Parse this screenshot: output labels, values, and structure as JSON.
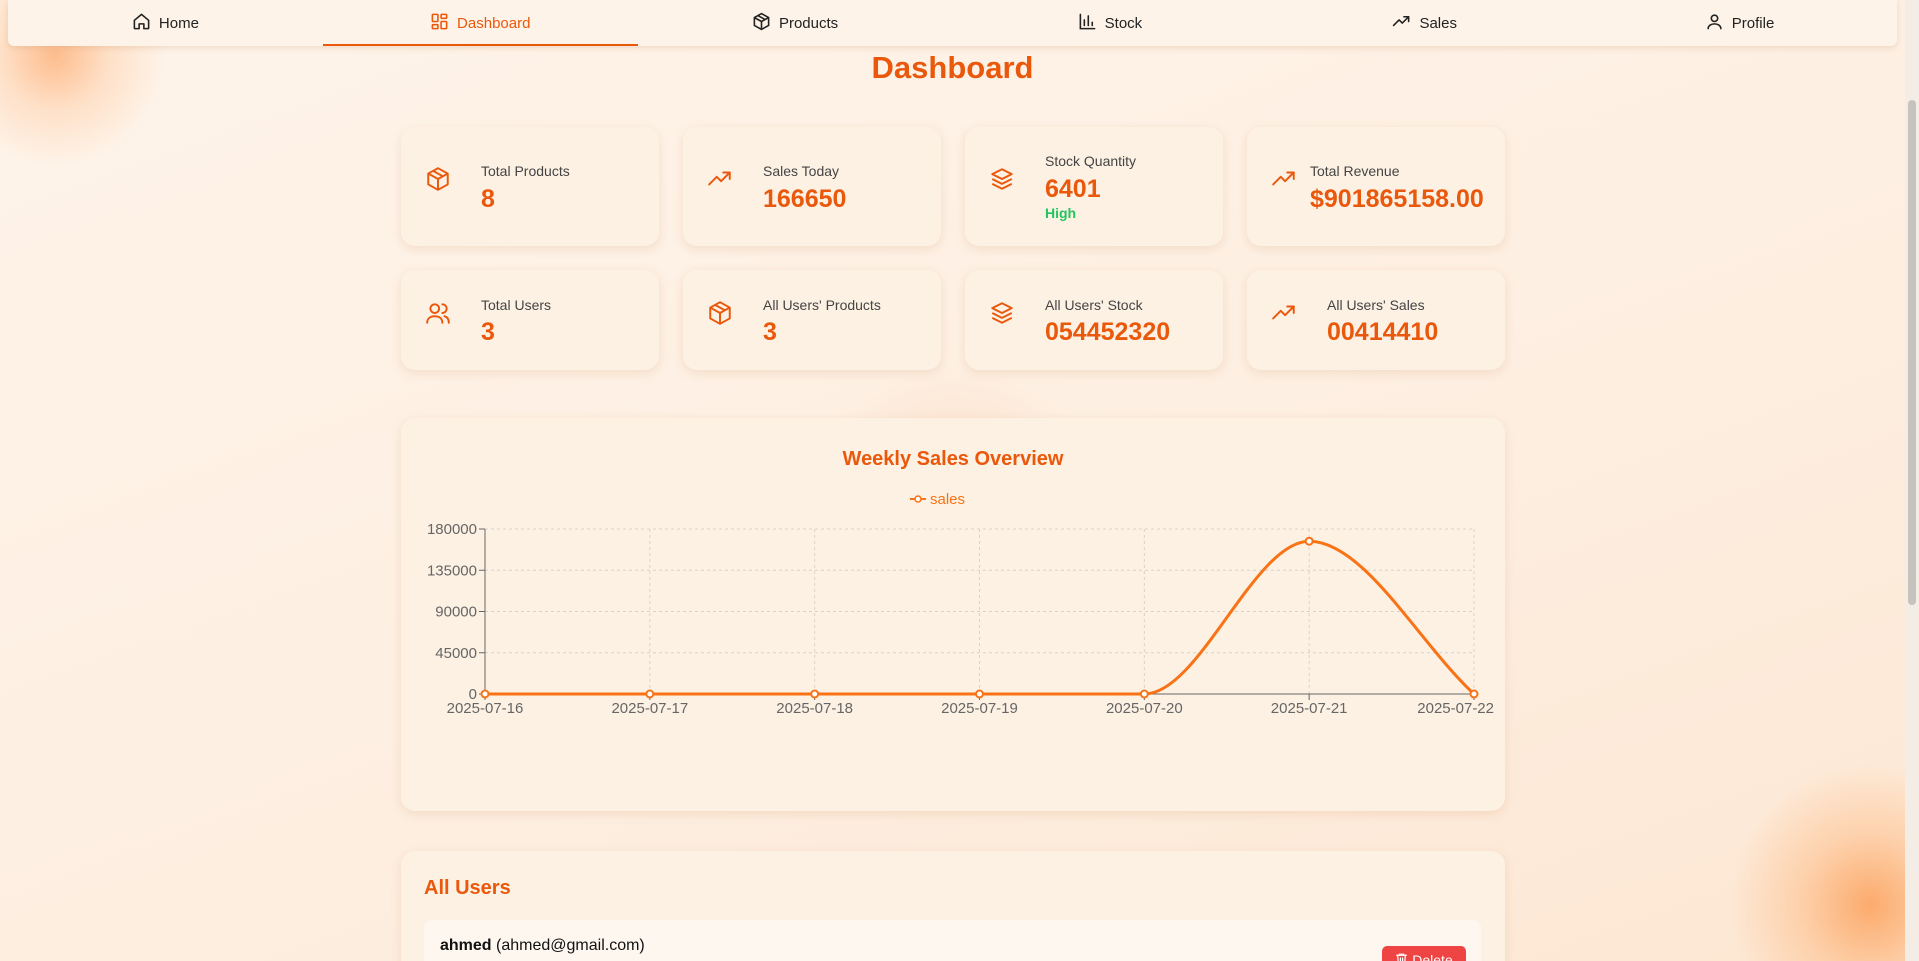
{
  "nav": {
    "items": [
      {
        "label": "Home",
        "icon": "home-icon"
      },
      {
        "label": "Dashboard",
        "icon": "dashboard-icon",
        "active": true
      },
      {
        "label": "Products",
        "icon": "box-icon"
      },
      {
        "label": "Stock",
        "icon": "bar-chart-icon"
      },
      {
        "label": "Sales",
        "icon": "trending-up-icon"
      },
      {
        "label": "Profile",
        "icon": "user-icon"
      }
    ]
  },
  "page_title": "Dashboard",
  "stats": {
    "total_products": {
      "label": "Total Products",
      "value": "8",
      "icon": "box-icon"
    },
    "sales_today": {
      "label": "Sales Today",
      "value": "166650",
      "icon": "trending-up-icon"
    },
    "stock_quantity": {
      "label": "Stock Quantity",
      "value": "6401",
      "status": "High",
      "icon": "layers-icon"
    },
    "total_revenue": {
      "label": "Total Revenue",
      "value": "$901865158.00",
      "icon": "trending-up-icon"
    },
    "total_users": {
      "label": "Total Users",
      "value": "3",
      "icon": "users-icon"
    },
    "all_users_products": {
      "label": "All Users' Products",
      "value": "3",
      "icon": "box-icon"
    },
    "all_users_stock": {
      "label": "All Users' Stock",
      "value": "054452320",
      "icon": "layers-icon"
    },
    "all_users_sales": {
      "label": "All Users' Sales",
      "value": "00414410",
      "icon": "trending-up-icon"
    }
  },
  "chart": {
    "title": "Weekly Sales Overview"
  },
  "chart_data": {
    "type": "line",
    "title": "Weekly Sales Overview",
    "x": [
      "2025-07-16",
      "2025-07-17",
      "2025-07-18",
      "2025-07-19",
      "2025-07-20",
      "2025-07-21",
      "2025-07-22"
    ],
    "series": [
      {
        "name": "sales",
        "values": [
          0,
          0,
          0,
          0,
          0,
          166650,
          0
        ],
        "color": "#f97316"
      }
    ],
    "yticks": [
      "0",
      "45000",
      "90000",
      "135000",
      "180000"
    ],
    "ylim": [
      0,
      180000
    ],
    "grid": true,
    "legend": "top-center",
    "curve": "smooth"
  },
  "users": {
    "title": "All Users",
    "list": [
      {
        "name": "ahmed",
        "email": "(ahmed@gmail.com)",
        "action": "Delete"
      }
    ]
  },
  "colors": {
    "accent": "#ea580c",
    "line": "#f97316",
    "status_high": "#22c55e",
    "danger": "#ef4444"
  }
}
